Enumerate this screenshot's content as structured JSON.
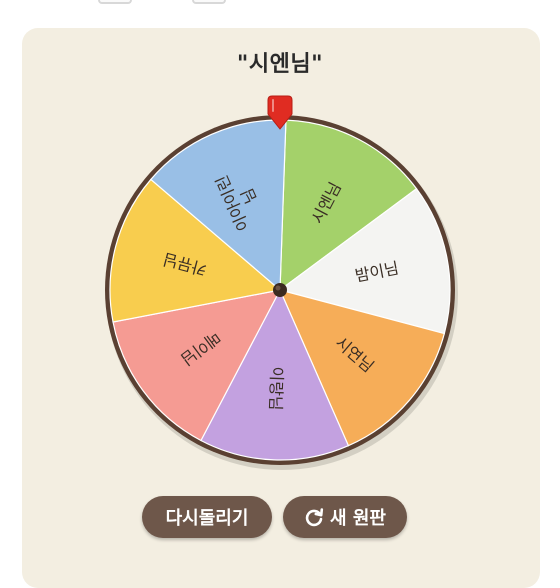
{
  "result_title": "\"시엔님\"",
  "wheel": {
    "segments": [
      {
        "label": "시엔님",
        "color": "#a4d16a"
      },
      {
        "label": "밤이님",
        "color": "#f4f4f2"
      },
      {
        "label": "시연님",
        "color": "#f6ad58"
      },
      {
        "label": "이랑님",
        "color": "#c3a1e0"
      },
      {
        "label": "메이님",
        "color": "#f59b93"
      },
      {
        "label": "카뮤님",
        "color": "#f8cd4e"
      },
      {
        "label": "이아이린\n님",
        "color": "#99bfe6"
      }
    ],
    "rim_color": "#5a4032",
    "pointer_color": "#e02c22"
  },
  "buttons": {
    "spin_label": "다시돌리기",
    "new_label": "새 원판"
  },
  "icons": {
    "pointer": "pointer-icon",
    "refresh": "refresh-icon"
  }
}
